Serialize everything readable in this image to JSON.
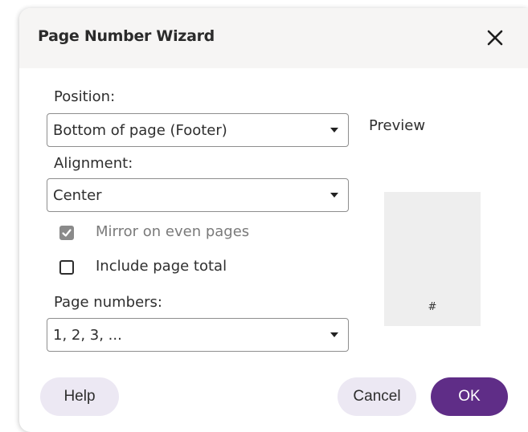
{
  "dialog": {
    "title": "Page Number Wizard"
  },
  "position": {
    "label": "Position:",
    "value": "Bottom of page (Footer)"
  },
  "alignment": {
    "label": "Alignment:",
    "value": "Center"
  },
  "options": {
    "mirror_label": "Mirror on even pages",
    "mirror_checked": true,
    "mirror_enabled": false,
    "total_label": "Include page total",
    "total_checked": false
  },
  "page_numbers": {
    "label": "Page numbers:",
    "value": "1, 2, 3, ..."
  },
  "preview": {
    "label": "Preview",
    "placeholder": "#"
  },
  "buttons": {
    "help": "Help",
    "cancel": "Cancel",
    "ok": "OK"
  },
  "colors": {
    "accent": "#5f2d87",
    "secondary_button_bg": "#ece8f3",
    "titlebar_bg": "#f6f5f4",
    "disabled_text": "#7a7a7a"
  },
  "icons": {
    "close": "close-icon",
    "dropdown": "chevron-down-icon",
    "check": "checkmark-icon"
  }
}
